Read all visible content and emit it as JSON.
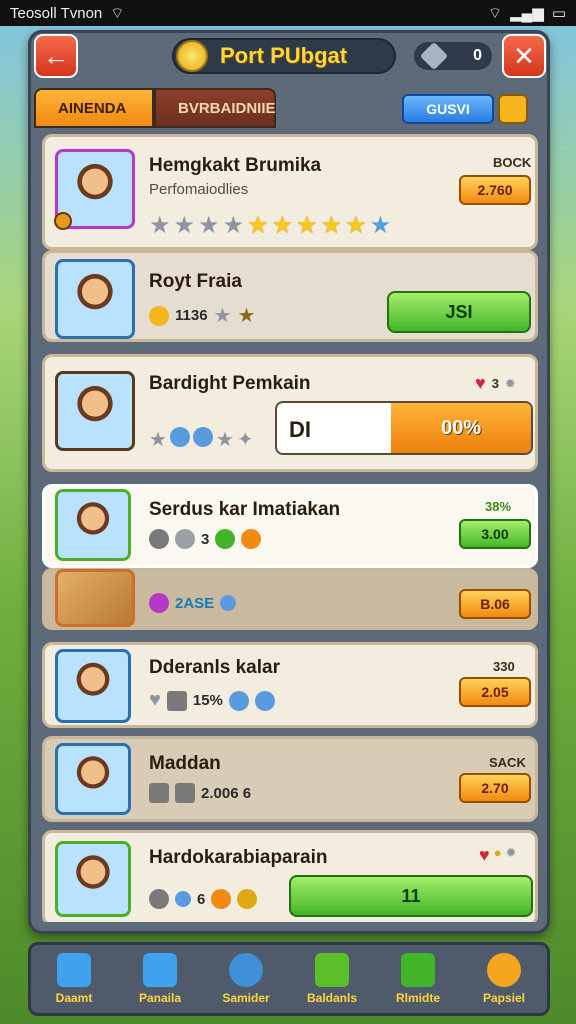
{
  "status_bar": {
    "carrier": "Teosoll Tvnon"
  },
  "header": {
    "title": "Port PUbgat",
    "gems": "0"
  },
  "tabs": [
    {
      "label": "AINENDA"
    },
    {
      "label": "BVRBAIDNIIE"
    }
  ],
  "save_label": "GUSVI",
  "cards": [
    {
      "name": "Hemgkakt Brumika",
      "sub": "Perfomaiodlies",
      "corner": "BOCK",
      "price": "2.760"
    },
    {
      "name": "Royt Fraia",
      "stat": "1136",
      "button": "JSI"
    },
    {
      "name": "Bardight Pemkain",
      "corner": "3",
      "progress_label": "DI",
      "progress_value": "00%",
      "progress_fraction": 0.55
    },
    {
      "name": "Serdus kar Imatiakan",
      "corner": "38%",
      "stat": "3",
      "price": "3.00"
    },
    {
      "stat": "2ASE",
      "price": "B.06"
    },
    {
      "name": "Dderanls kalar",
      "corner": "330",
      "stat": "15%",
      "price": "2.05"
    },
    {
      "name": "Maddan",
      "corner": "SACK",
      "stat": "2.006 6",
      "price": "2.70"
    },
    {
      "name": "Hardokarabiaparain",
      "stat": "6",
      "button": "11"
    }
  ],
  "nav": [
    {
      "label": "Daamt",
      "icon": "home-icon"
    },
    {
      "label": "Panaila",
      "icon": "shop-icon"
    },
    {
      "label": "Samider",
      "icon": "gear-icon"
    },
    {
      "label": "Baldanls",
      "icon": "build-icon"
    },
    {
      "label": "Rlmidte",
      "icon": "quest-icon"
    },
    {
      "label": "Papsiel",
      "icon": "sun-icon"
    }
  ],
  "colors": {
    "accent": "#f08a12",
    "green": "#43b52a",
    "frame": "#5d6a79"
  }
}
